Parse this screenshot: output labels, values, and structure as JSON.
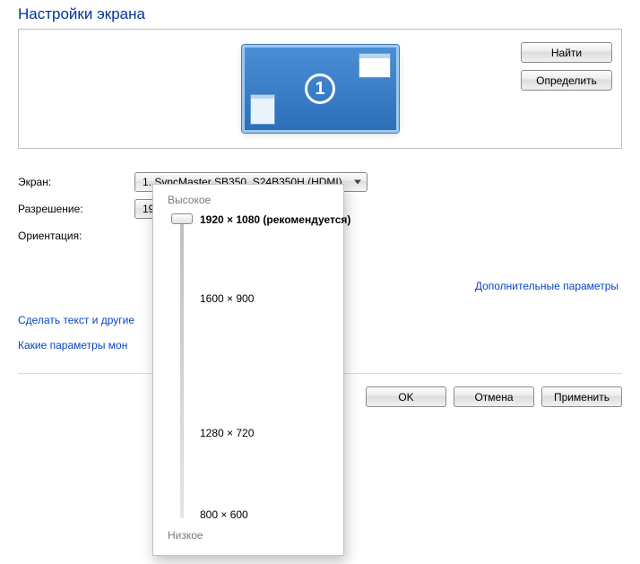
{
  "title": "Настройки экрана",
  "monitor_number": "1",
  "buttons": {
    "find": "Найти",
    "identify": "Определить",
    "ok": "OK",
    "cancel": "Отмена",
    "apply": "Применить"
  },
  "labels": {
    "screen": "Экран:",
    "resolution": "Разрешение:",
    "orientation": "Ориентация:"
  },
  "screen_combo": "1. SyncMaster SB350_S24B350H (HDMI)",
  "resolution_combo": "1920 × 1080 (рекомендуется)",
  "links": {
    "advanced": "Дополнительные параметры",
    "text_size": "Сделать текст и другие",
    "which_params": "Какие параметры мон"
  },
  "popup": {
    "high": "Высокое",
    "low": "Низкое",
    "options": [
      {
        "label": "1920 × 1080 (рекомендуется)",
        "pos": 2.5,
        "bold": true
      },
      {
        "label": "1600 × 900",
        "pos": 28
      },
      {
        "label": "1280 × 720",
        "pos": 71
      },
      {
        "label": "800 × 600",
        "pos": 97
      }
    ]
  }
}
